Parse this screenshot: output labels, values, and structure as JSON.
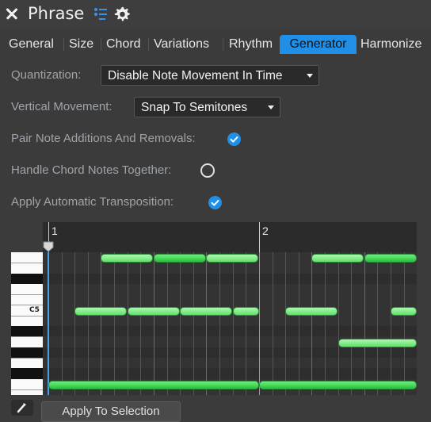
{
  "window": {
    "title": "Phrase"
  },
  "tabs": [
    {
      "label": "General",
      "active": false
    },
    {
      "label": "Size",
      "active": false
    },
    {
      "label": "Chord",
      "active": false
    },
    {
      "label": "Variations",
      "active": false
    },
    {
      "label": "Rhythm",
      "active": false
    },
    {
      "label": "Generator",
      "active": true
    },
    {
      "label": "Harmonize",
      "active": false
    }
  ],
  "settings": {
    "quantization": {
      "label": "Quantization:",
      "value": "Disable Note Movement In Time"
    },
    "vertical_movement": {
      "label": "Vertical Movement:",
      "value": "Snap To Semitones"
    },
    "pair_note": {
      "label": "Pair Note Additions And Removals:",
      "checked": true
    },
    "handle_chord": {
      "label": "Handle Chord Notes Together:",
      "checked": false
    },
    "auto_transpose": {
      "label": "Apply Automatic Transposition:",
      "checked": true
    }
  },
  "piano_roll": {
    "bar_labels": [
      "1",
      "2"
    ],
    "key_label": "C5"
  },
  "bottom": {
    "apply_label": "Apply To Selection"
  },
  "colors": {
    "accent": "#1f8fe8",
    "note": "#5fe06a"
  },
  "icons": [
    "close-icon",
    "list-icon",
    "gear-icon",
    "checkmark-icon",
    "magic-wand-icon"
  ]
}
